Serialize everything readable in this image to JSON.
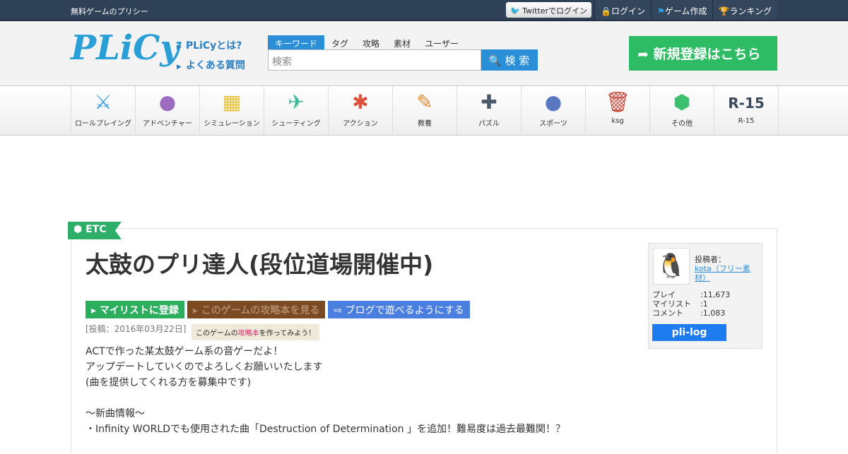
{
  "topbar": {
    "site_name": "無料ゲームのプリシー",
    "twitter": "Twitterでログイン",
    "login": "ログイン",
    "create": "ゲーム作成",
    "ranking": "ランキング"
  },
  "header": {
    "logo": "PLiCy",
    "links": [
      "PLiCyとは?",
      "よくある質問"
    ],
    "search_tabs": [
      "キーワード",
      "タグ",
      "攻略",
      "素材",
      "ユーザー"
    ],
    "search_placeholder": "検索",
    "search_button": "検 索",
    "register": "新規登録はこちら"
  },
  "categories": [
    {
      "label": "ロールプレイング",
      "icon": "⚔",
      "color": "#3fa0e0"
    },
    {
      "label": "アドベンチャー",
      "icon": "●",
      "color": "#9b6cc0"
    },
    {
      "label": "シミュレーション",
      "icon": "▦",
      "color": "#e8c230"
    },
    {
      "label": "シューティング",
      "icon": "✈",
      "color": "#3cb89a"
    },
    {
      "label": "アクション",
      "icon": "✱",
      "color": "#e0503c"
    },
    {
      "label": "教養",
      "icon": "✎",
      "color": "#e88a30"
    },
    {
      "label": "パズル",
      "icon": "✚",
      "color": "#4a5868"
    },
    {
      "label": "スポーツ",
      "icon": "●",
      "color": "#5a78c0"
    },
    {
      "label": "ksg",
      "icon": "🗑",
      "color": "#c8453a"
    },
    {
      "label": "その他",
      "icon": "⬢",
      "color": "#3cc070"
    },
    {
      "label": "R-15",
      "icon": "R-15",
      "color": "#3a4a5c"
    }
  ],
  "game": {
    "category": "ETC",
    "title": "太鼓のプリ達人(段位道場開催中)",
    "mylist": "マイリストに登録",
    "guide": "このゲームの攻略本を見る",
    "blog": "ブログで遊べるようにする",
    "date": "[投稿：2016年03月22日]",
    "tip_pre": "このゲームの",
    "tip_pink": "攻略本",
    "tip_post": "を作ってみよう！",
    "description": [
      "ACTで作った某太鼓ゲーム系の音ゲーだよ！",
      "アップデートしていくのでよろしくお願いいたします",
      "(曲を提供してくれる方を募集中です)",
      "",
      "〜新曲情報〜",
      "・Infinity WORLDでも使用された曲「Destruction of Determination 」を追加！難易度は過去最難関！？"
    ]
  },
  "sidebar": {
    "poster_label": "投稿者：",
    "poster_name": "kota（フリー素材）",
    "stats": [
      {
        "k": "プレイ",
        "v": ":11,673"
      },
      {
        "k": "マイリスト",
        "v": ":1"
      },
      {
        "k": "コメント",
        "v": ":1,083"
      }
    ],
    "plilog": "pli-log"
  }
}
